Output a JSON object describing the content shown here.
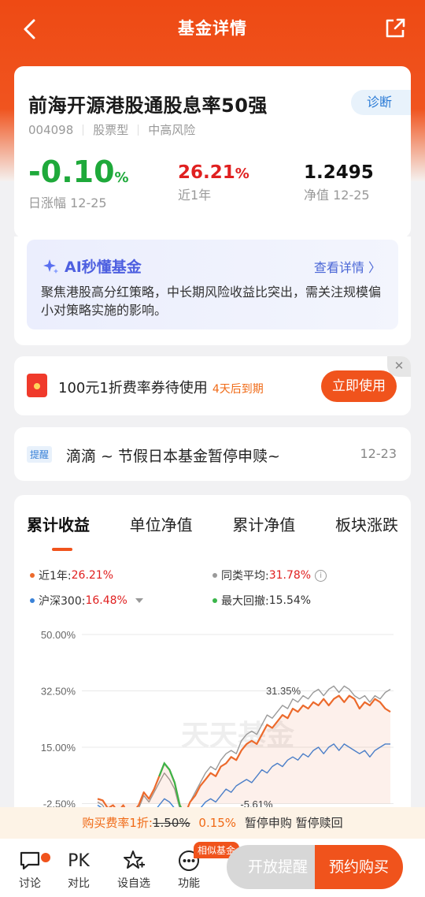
{
  "nav": {
    "title": "基金详情"
  },
  "fund": {
    "name": "前海开源港股通股息率50强",
    "diagnose_label": "诊断",
    "code": "004098",
    "type": "股票型",
    "risk": "中高风险",
    "daily_change": "-0.10",
    "daily_change_unit": "%",
    "daily_change_label": "日涨幅 12-25",
    "year_return": "26.21",
    "year_return_unit": "%",
    "year_return_label": "近1年",
    "nav_value": "1.2495",
    "nav_label": "净值 12-25"
  },
  "ai": {
    "title": "AI秒懂基金",
    "more": "查看详情 〉",
    "text": "聚焦港股高分红策略，中长期风险收益比突出，需关注规模偏小对策略实施的影响。"
  },
  "coupon": {
    "text": "100元1折费率券待使用",
    "expire": "4天后到期",
    "button": "立即使用",
    "close": "✕"
  },
  "notice": {
    "tag": "提醒",
    "text": "滴滴 ~ 节假日本基金暂停申赎~",
    "date": "12-23"
  },
  "tabs": [
    "累计收益",
    "单位净值",
    "累计净值",
    "板块涨跌"
  ],
  "legend": {
    "fund": "近1年:",
    "fund_val": "26.21%",
    "peer": "同类平均:",
    "peer_val": "31.78%",
    "hs300": "沪深300:",
    "hs300_val": "16.48%",
    "drawdown": "最大回撤:",
    "drawdown_val": "15.54%"
  },
  "colors": {
    "accent": "#f0531c",
    "fund": "#ec6a2c",
    "peer": "#9a9a9a",
    "hs300": "#3a82d8",
    "drawdown": "#3ab54a"
  },
  "chart_data": {
    "type": "line",
    "yticks": [
      "50.00%",
      "32.50%",
      "15.00%",
      "-2.50%"
    ],
    "ylim": [
      -2.5,
      50
    ],
    "annotations": [
      "31.35%",
      "-5.61%"
    ],
    "watermark": "天天基金",
    "series": [
      {
        "name": "近1年",
        "values": [
          -1,
          -1.5,
          -4,
          -3,
          -5,
          -3,
          -6,
          -5,
          -3,
          1,
          -1,
          2,
          6,
          10,
          8,
          4,
          -3,
          -6,
          -2,
          0,
          3,
          5,
          7,
          6,
          9,
          10,
          12,
          11,
          14,
          16,
          17,
          16,
          19,
          22,
          21,
          23,
          25,
          24,
          27,
          26,
          28,
          27,
          29,
          28,
          30,
          28,
          30,
          31,
          29,
          31,
          30,
          27,
          29,
          28,
          30,
          29,
          27,
          26
        ]
      },
      {
        "name": "同类平均",
        "values": [
          -2,
          -3,
          -6,
          -5,
          -7,
          -5,
          -8,
          -6,
          -4,
          0,
          -2,
          1,
          4,
          7,
          5,
          2,
          -4,
          -6,
          -2,
          1,
          4,
          7,
          9,
          8,
          11,
          13,
          14,
          13,
          17,
          19,
          20,
          19,
          22,
          25,
          24,
          26,
          28,
          27,
          30,
          29,
          31,
          30,
          32,
          33,
          31,
          33,
          34,
          32,
          34,
          33,
          31,
          30,
          31,
          29,
          31,
          30,
          32,
          33
        ]
      },
      {
        "name": "沪深300",
        "values": [
          -3,
          -4,
          -6,
          -5,
          -8,
          -6,
          -9,
          -8,
          -7,
          -5,
          -6,
          -5,
          -3,
          -1,
          -2,
          -4,
          -7,
          -8,
          -6,
          -5,
          -4,
          -2,
          -1,
          -2,
          0,
          2,
          1,
          3,
          4,
          5,
          4,
          6,
          8,
          7,
          9,
          10,
          9,
          11,
          12,
          11,
          13,
          12,
          14,
          15,
          13,
          15,
          16,
          14,
          16,
          15,
          14,
          13,
          14,
          12,
          14,
          15,
          16,
          16
        ]
      }
    ]
  },
  "fee": {
    "prefix": "购买费率1折:",
    "old": "1.50%",
    "new": "0.15%",
    "suffix": "暂停申购 暂停赎回"
  },
  "bottom": {
    "discuss": "讨论",
    "compare_icon": "PK",
    "compare": "对比",
    "watch": "设自选",
    "func": "功能",
    "similar": "相似基金",
    "open_remind": "开放提醒",
    "reserve": "预约购买"
  }
}
